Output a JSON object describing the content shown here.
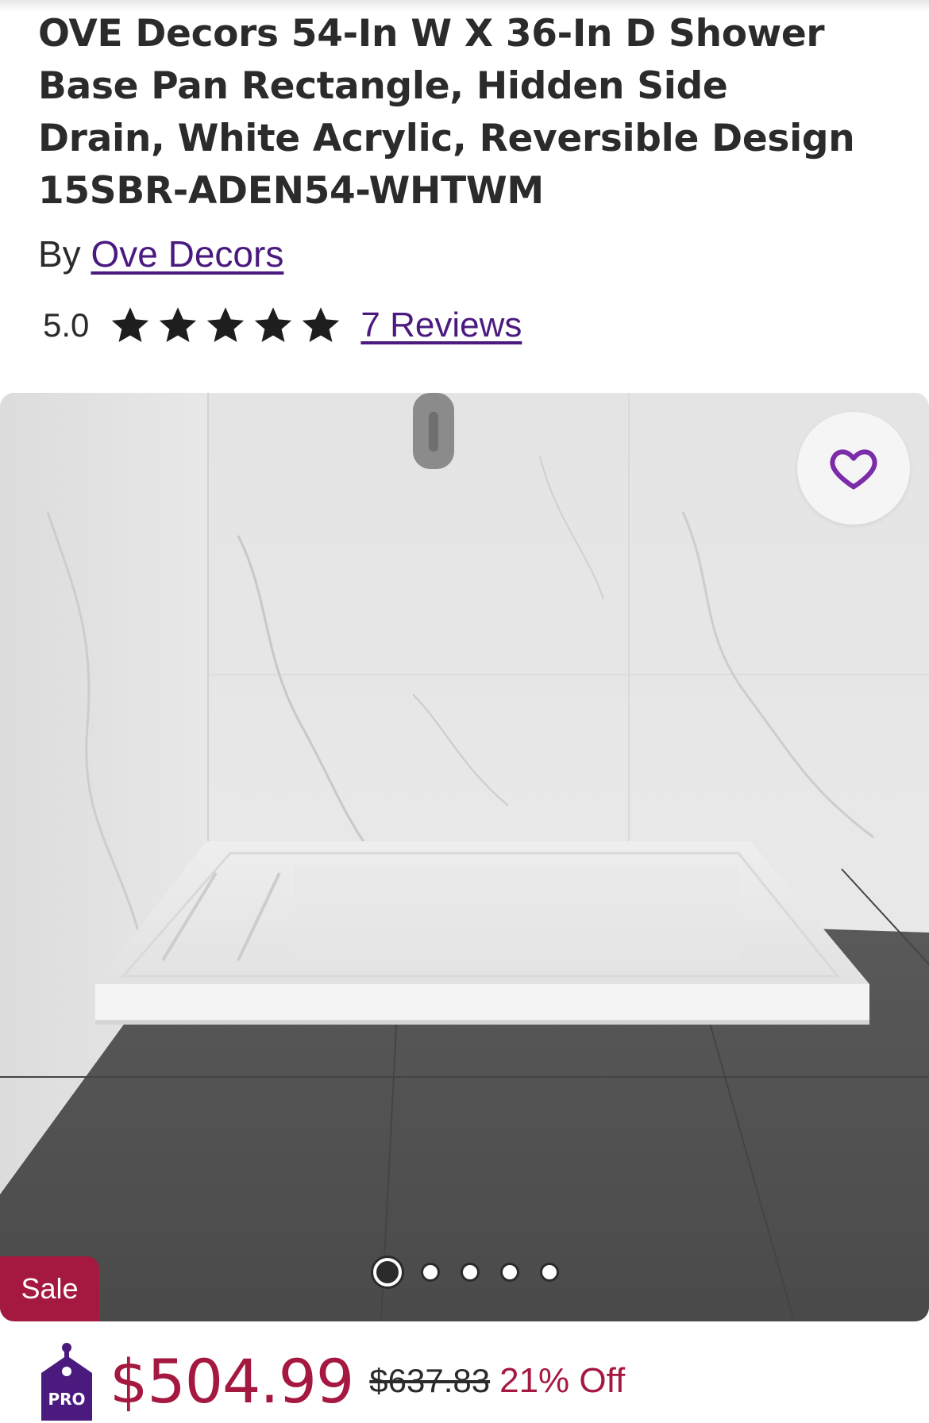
{
  "product": {
    "title": "OVE Decors 54-In W X 36-In D Shower Base Pan Rectangle, Hidden Side Drain, White Acrylic, Reversible Design 15SBR-ADEN54-WHTWM",
    "by_label": "By",
    "brand": "Ove Decors",
    "rating_value": "5.0",
    "rating": 5,
    "rating_max": 5,
    "reviews_label": "7 Reviews"
  },
  "gallery": {
    "sale_badge": "Sale",
    "favorite_icon": "heart-icon",
    "image_count": 5,
    "active_index": 0
  },
  "pricing": {
    "badge_label": "PRO",
    "sale_price": "$504.99",
    "original_price": "$637.83",
    "discount": "21% Off"
  },
  "colors": {
    "brand_purple": "#4b1a7f",
    "heart_purple": "#7b2ca8",
    "sale_red": "#a51840",
    "text_dark": "#2b2b2b"
  }
}
